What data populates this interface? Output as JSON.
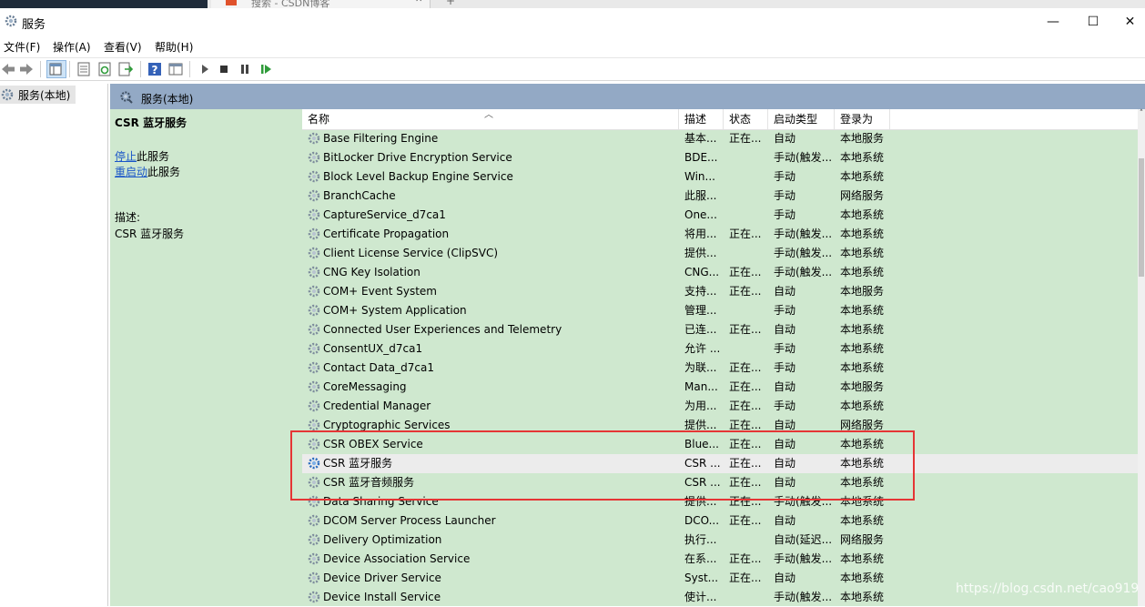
{
  "browser": {
    "tab_title": "搜索 - CSDN博客",
    "new_tab": "+"
  },
  "window": {
    "title": "服务",
    "controls": {
      "minimize": "—",
      "maximize": "☐",
      "close": "✕"
    }
  },
  "menu": [
    "文件(F)",
    "操作(A)",
    "查看(V)",
    "帮助(H)"
  ],
  "toolbar": {
    "icons": [
      "back-icon",
      "forward-icon",
      "show-tree-icon",
      "properties-icon",
      "refresh-icon",
      "export-icon",
      "help-icon",
      "view-icon",
      "start-service-icon",
      "stop-service-icon",
      "pause-service-icon",
      "restart-service-icon"
    ]
  },
  "tree": {
    "root": "服务(本地)"
  },
  "pane_header": "服务(本地)",
  "detail": {
    "title": "CSR 蓝牙服务",
    "stop_link": "停止",
    "stop_suffix": "此服务",
    "restart_link": "重启动",
    "restart_suffix": "此服务",
    "desc_label": "描述:",
    "desc_text": "CSR 蓝牙服务"
  },
  "columns": [
    "名称",
    "描述",
    "状态",
    "启动类型",
    "登录为"
  ],
  "services": [
    {
      "name": "Base Filtering Engine",
      "desc": "基本...",
      "status": "正在...",
      "startup": "自动",
      "logon": "本地服务"
    },
    {
      "name": "BitLocker Drive Encryption Service",
      "desc": "BDE...",
      "status": "",
      "startup": "手动(触发...",
      "logon": "本地系统"
    },
    {
      "name": "Block Level Backup Engine Service",
      "desc": "Win...",
      "status": "",
      "startup": "手动",
      "logon": "本地系统"
    },
    {
      "name": "BranchCache",
      "desc": "此服...",
      "status": "",
      "startup": "手动",
      "logon": "网络服务"
    },
    {
      "name": "CaptureService_d7ca1",
      "desc": "One...",
      "status": "",
      "startup": "手动",
      "logon": "本地系统"
    },
    {
      "name": "Certificate Propagation",
      "desc": "将用...",
      "status": "正在...",
      "startup": "手动(触发...",
      "logon": "本地系统"
    },
    {
      "name": "Client License Service (ClipSVC)",
      "desc": "提供...",
      "status": "",
      "startup": "手动(触发...",
      "logon": "本地系统"
    },
    {
      "name": "CNG Key Isolation",
      "desc": "CNG...",
      "status": "正在...",
      "startup": "手动(触发...",
      "logon": "本地系统"
    },
    {
      "name": "COM+ Event System",
      "desc": "支持...",
      "status": "正在...",
      "startup": "自动",
      "logon": "本地服务"
    },
    {
      "name": "COM+ System Application",
      "desc": "管理...",
      "status": "",
      "startup": "手动",
      "logon": "本地系统"
    },
    {
      "name": "Connected User Experiences and Telemetry",
      "desc": "已连...",
      "status": "正在...",
      "startup": "自动",
      "logon": "本地系统"
    },
    {
      "name": "ConsentUX_d7ca1",
      "desc": "允许 ...",
      "status": "",
      "startup": "手动",
      "logon": "本地系统"
    },
    {
      "name": "Contact Data_d7ca1",
      "desc": "为联...",
      "status": "正在...",
      "startup": "手动",
      "logon": "本地系统"
    },
    {
      "name": "CoreMessaging",
      "desc": "Man...",
      "status": "正在...",
      "startup": "自动",
      "logon": "本地服务"
    },
    {
      "name": "Credential Manager",
      "desc": "为用...",
      "status": "正在...",
      "startup": "手动",
      "logon": "本地系统"
    },
    {
      "name": "Cryptographic Services",
      "desc": "提供...",
      "status": "正在...",
      "startup": "自动",
      "logon": "网络服务"
    },
    {
      "name": "CSR OBEX Service",
      "desc": "Blue...",
      "status": "正在...",
      "startup": "自动",
      "logon": "本地系统"
    },
    {
      "name": "CSR 蓝牙服务",
      "desc": "CSR ...",
      "status": "正在...",
      "startup": "自动",
      "logon": "本地系统"
    },
    {
      "name": "CSR 蓝牙音频服务",
      "desc": "CSR ...",
      "status": "正在...",
      "startup": "自动",
      "logon": "本地系统"
    },
    {
      "name": "Data Sharing Service",
      "desc": "提供...",
      "status": "正在...",
      "startup": "手动(触发...",
      "logon": "本地系统"
    },
    {
      "name": "DCOM Server Process Launcher",
      "desc": "DCO...",
      "status": "正在...",
      "startup": "自动",
      "logon": "本地系统"
    },
    {
      "name": "Delivery Optimization",
      "desc": "执行...",
      "status": "",
      "startup": "自动(延迟...",
      "logon": "网络服务"
    },
    {
      "name": "Device Association Service",
      "desc": "在系...",
      "status": "正在...",
      "startup": "手动(触发...",
      "logon": "本地系统"
    },
    {
      "name": "Device Driver Service",
      "desc": "Syst...",
      "status": "正在...",
      "startup": "自动",
      "logon": "本地系统"
    },
    {
      "name": "Device Install Service",
      "desc": "使计...",
      "status": "",
      "startup": "手动(触发...",
      "logon": "本地系统"
    }
  ],
  "selected_index": 17,
  "watermark": "https://blog.csdn.net/cao919",
  "colors": {
    "list_bg": "#cfe8cf",
    "header_bg": "#93a9c5",
    "highlight_box": "#e53535",
    "link": "#1a56c8"
  }
}
